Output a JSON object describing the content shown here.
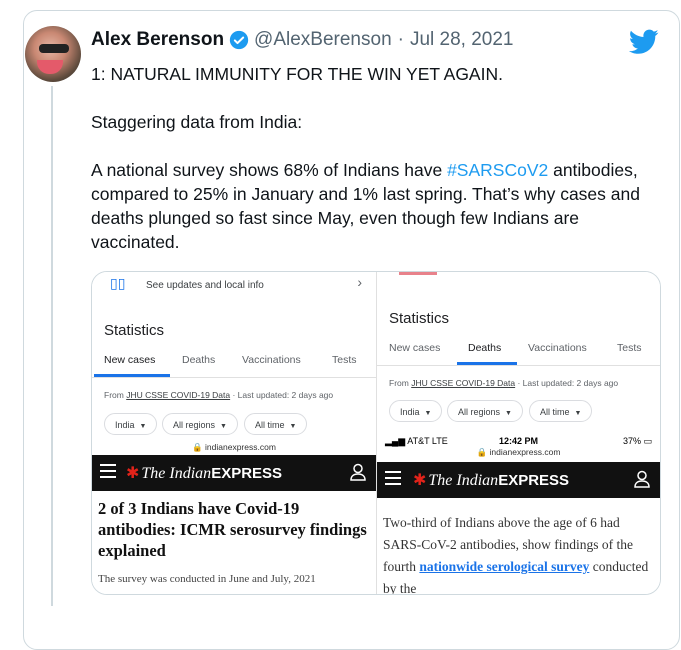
{
  "tweet": {
    "author_name": "Alex Berenson",
    "handle": "@AlexBerenson",
    "separator": "·",
    "date": "Jul 28, 2021",
    "text_line1": "1: NATURAL IMMUNITY FOR THE WIN YET AGAIN.",
    "text_line2": "Staggering data from India:",
    "text_p3_before": "A national survey shows 68% of Indians have ",
    "hashtag": "#SARSCoV2",
    "text_p3_after": " antibodies, compared to 25% in January and 1% last spring. That’s why cases and deaths plunged so fast since May, even though few Indians are vaccinated."
  },
  "media": {
    "left": {
      "updates_text": "See updates and local info",
      "stats_title": "Statistics",
      "tabs": [
        "New cases",
        "Deaths",
        "Vaccinations",
        "Tests"
      ],
      "source_prefix": "From ",
      "source_link": "JHU CSSE COVID-19 Data",
      "source_suffix": " · Last updated: 2 days ago",
      "chips": [
        "India",
        "All regions",
        "All time"
      ],
      "url": "indianexpress.com",
      "logo_the": "The Indian",
      "logo_express": "EXPRESS",
      "headline": "2 of 3 Indians have Covid-19 antibodies: ICMR serosurvey findings explained",
      "subline": "The survey was conducted in June and July, 2021"
    },
    "right": {
      "stats_title": "Statistics",
      "tabs": [
        "New cases",
        "Deaths",
        "Vaccinations",
        "Tests"
      ],
      "source_prefix": "From ",
      "source_link": "JHU CSSE COVID-19 Data",
      "source_suffix": " · Last updated: 2 days ago",
      "chips": [
        "India",
        "All regions",
        "All time"
      ],
      "carrier": "AT&T  LTE",
      "time": "12:42 PM",
      "battery": "37%",
      "url": "indianexpress.com",
      "logo_the": "The Indian",
      "logo_express": "EXPRESS",
      "article_before": "Two-third of Indians above the age of 6 had SARS-CoV-2 antibodies, show findings of the fourth ",
      "article_link": "nationwide serological survey",
      "article_after": " conducted by the"
    }
  },
  "colors": {
    "link_blue": "#1d9bf0",
    "text_primary": "#0f1419",
    "text_secondary": "#536471",
    "google_blue": "#1a73e8",
    "express_red": "#e2231a"
  }
}
